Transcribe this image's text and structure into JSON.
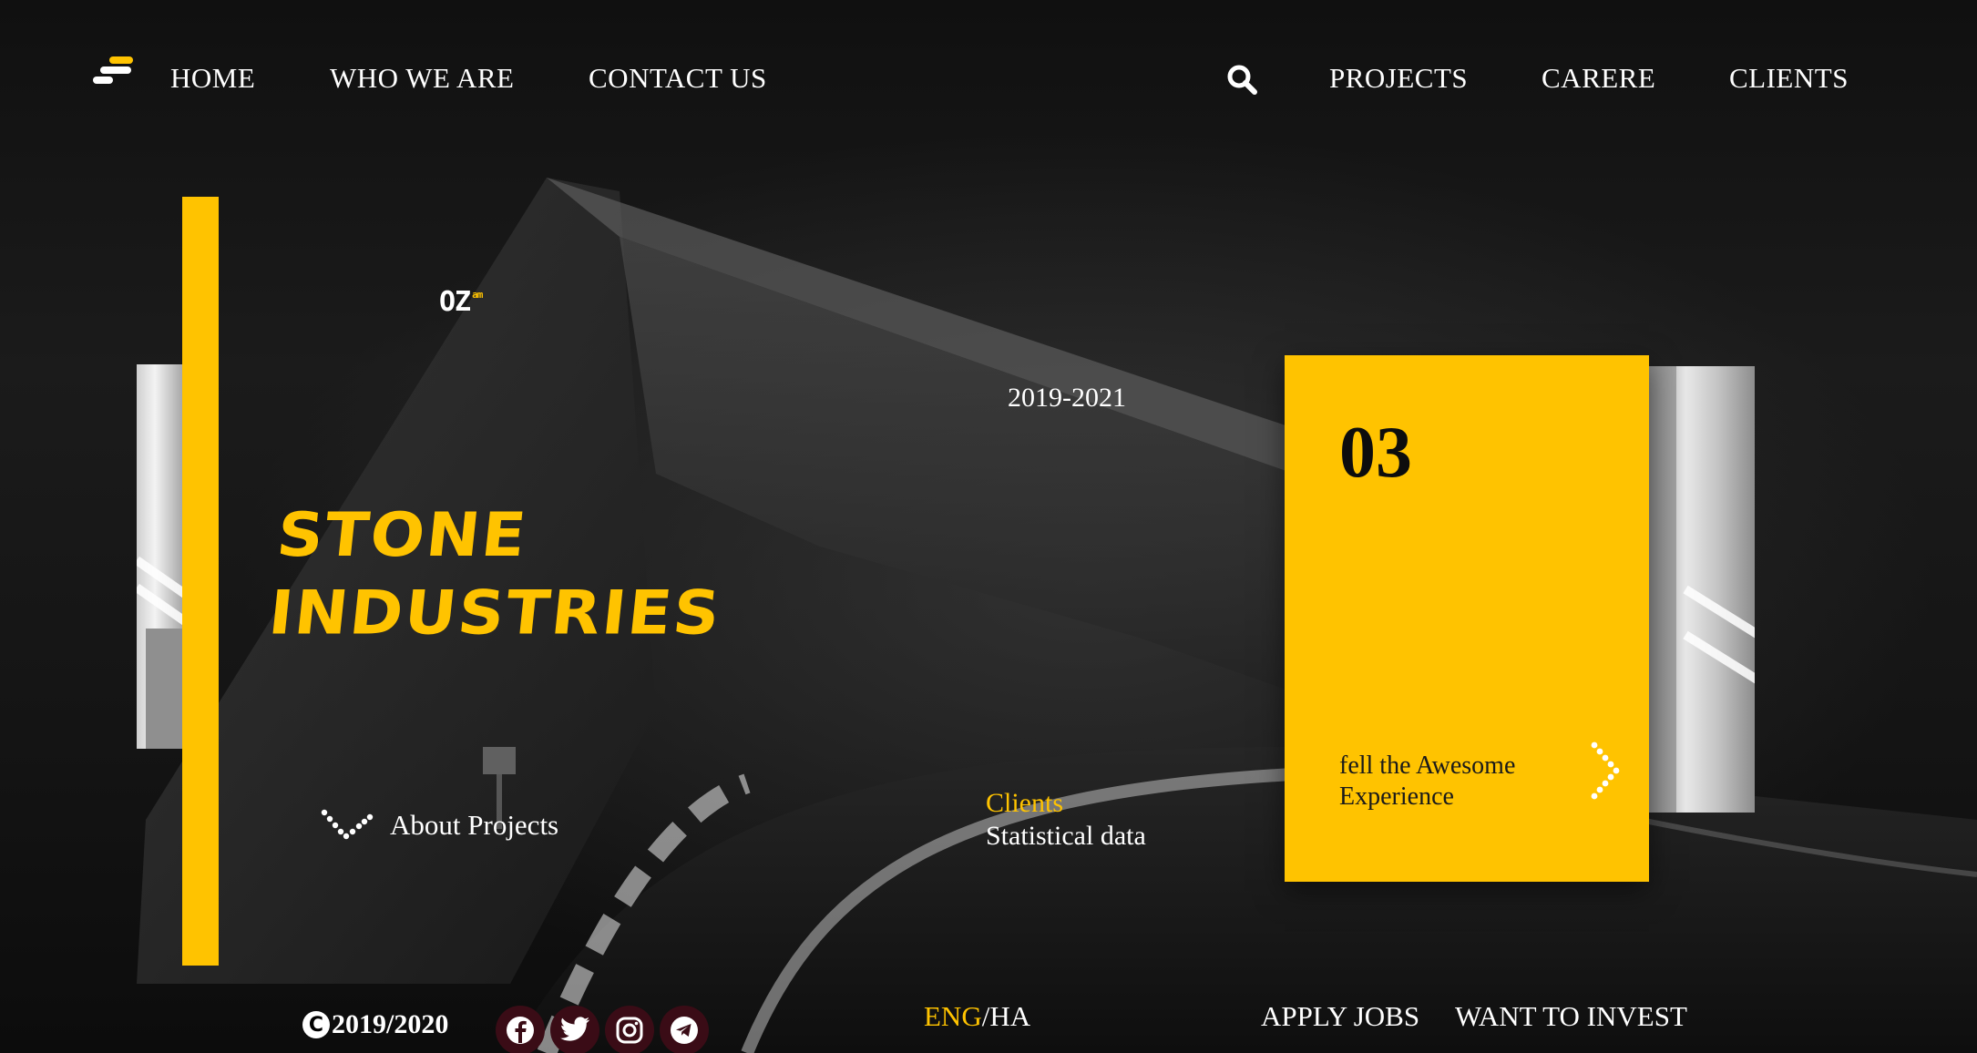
{
  "theme": {
    "accent": "#FFC300",
    "background": "#151515",
    "text": "#FFFFFF",
    "social_bg": "#3A0C16"
  },
  "nav": {
    "logo_icon": "menu-bars-icon",
    "left_links": [
      "HOME",
      "WHO WE ARE",
      "CONTACT US"
    ],
    "search_icon": "search-icon",
    "right_links": [
      "PROJECTS",
      "CARERE",
      "CLIENTS"
    ]
  },
  "mini_logo": {
    "text": "OZ",
    "sup": "am"
  },
  "hero": {
    "years": "2019-2021",
    "title_line1": "STONE",
    "title_line2": "INDUSTRIES",
    "about_label": "About Projects",
    "about_icon": "dotted-chevron-down-icon"
  },
  "stats": {
    "label": "Clients",
    "value": "Statistical data"
  },
  "card": {
    "number": "03",
    "tagline": "fell the Awesome Experience",
    "arrow_icon": "dotted-chevron-right-icon"
  },
  "footer": {
    "copyright_icon": "copyright-icon",
    "copyright_years": "2019/2020",
    "social": [
      "facebook-icon",
      "twitter-icon",
      "instagram-icon",
      "telegram-icon"
    ],
    "lang_active": "ENG",
    "lang_sep": "/",
    "lang_other": "HA",
    "links": [
      "APPLY JOBS",
      "WANT TO INVEST"
    ]
  }
}
